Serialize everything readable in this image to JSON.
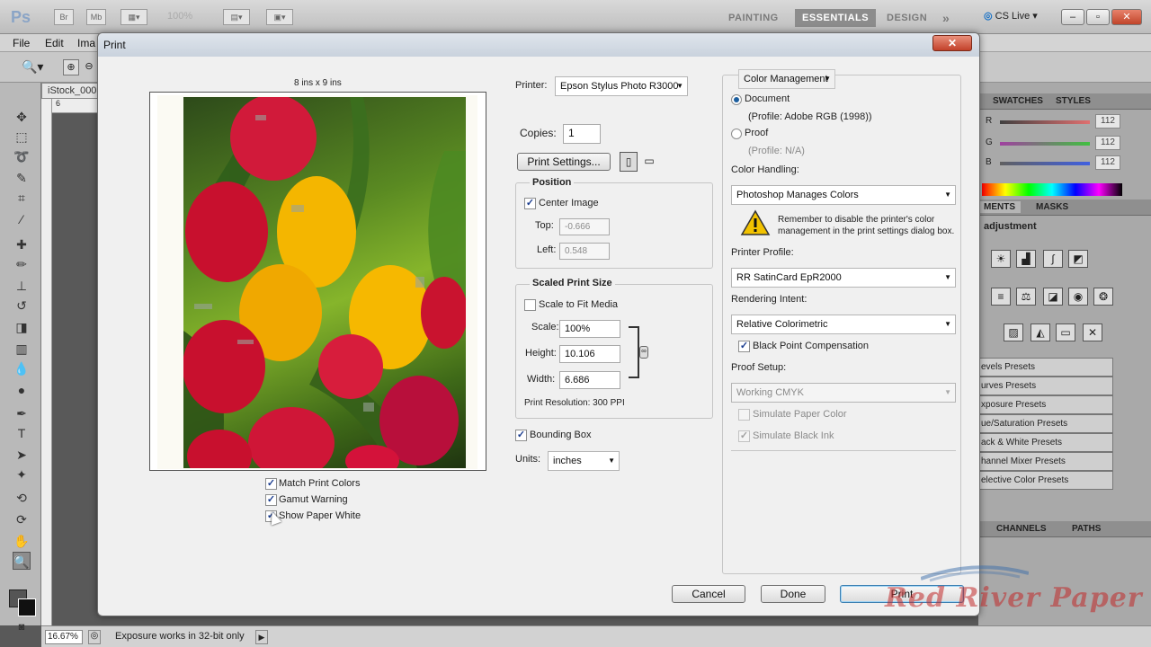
{
  "app": {
    "logo": "Ps",
    "app_buttons": [
      "Br",
      "Mb"
    ],
    "zoom_level": "100%",
    "workspaces": [
      "PAINTING",
      "ESSENTIALS",
      "DESIGN"
    ],
    "active_workspace": "ESSENTIALS",
    "more_workspaces": "»",
    "cs_live": "CS Live",
    "window_controls": [
      "–",
      "▫",
      "✕"
    ]
  },
  "menu": [
    "File",
    "Edit",
    "Ima"
  ],
  "document": {
    "tab_label": "iStock_000",
    "ruler_number": "6",
    "zoom_status": "16.67%",
    "status_message": "Exposure works in 32-bit only"
  },
  "panels": {
    "color_tabs": [
      "SWATCHES",
      "STYLES"
    ],
    "sliders": [
      {
        "label": "R",
        "value": "112",
        "from": "#404040",
        "to": "#e07070"
      },
      {
        "label": "G",
        "value": "112",
        "from": "#a040a0",
        "to": "#40c040"
      },
      {
        "label": "B",
        "value": "112",
        "from": "#606060",
        "to": "#4060e0"
      }
    ],
    "adjust_tabs": [
      "ADJUSTMENTS",
      "MASKS"
    ],
    "adjust_tab_visible": "MENTS",
    "adjust_title": "adjustment",
    "presets": [
      "evels Presets",
      "urves Presets",
      "xposure Presets",
      "ue/Saturation Presets",
      "ack & White Presets",
      "hannel Mixer Presets",
      "elective Color Presets"
    ],
    "bottom_tabs": [
      "CHANNELS",
      "PATHS"
    ]
  },
  "dialog": {
    "title": "Print",
    "close_label": "✕",
    "preview_size": "8 ins x 9 ins",
    "preview_options": [
      {
        "label": "Match Print Colors",
        "checked": true
      },
      {
        "label": "Gamut Warning",
        "checked": true
      },
      {
        "label": "Show Paper White",
        "checked": true
      }
    ],
    "printer_label": "Printer:",
    "printer_value": "Epson Stylus Photo R3000",
    "copies_label": "Copies:",
    "copies_value": "1",
    "print_settings_button": "Print Settings...",
    "position": {
      "title": "Position",
      "center_image": "Center Image",
      "top_label": "Top:",
      "top_value": "-0.666",
      "left_label": "Left:",
      "left_value": "0.548"
    },
    "scaled": {
      "title": "Scaled Print Size",
      "scale_to_fit": "Scale to Fit Media",
      "scale_label": "Scale:",
      "scale_value": "100%",
      "height_label": "Height:",
      "height_value": "10.106",
      "width_label": "Width:",
      "width_value": "6.686",
      "resolution": "Print Resolution: 300 PPI"
    },
    "bounding_box": "Bounding Box",
    "units_label": "Units:",
    "units_value": "inches",
    "color_management": {
      "dropdown": "Color Management",
      "document_label": "Document",
      "document_profile": "(Profile: Adobe RGB (1998))",
      "proof_label": "Proof",
      "proof_profile": "(Profile: N/A)",
      "color_handling_label": "Color Handling:",
      "color_handling_value": "Photoshop Manages Colors",
      "warning_text": "Remember to disable the printer's color management in the print settings dialog box.",
      "printer_profile_label": "Printer Profile:",
      "printer_profile_value": "RR SatinCard EpR2000",
      "rendering_intent_label": "Rendering Intent:",
      "rendering_intent_value": "Relative Colorimetric",
      "black_point": "Black Point Compensation",
      "proof_setup_label": "Proof Setup:",
      "proof_setup_value": "Working CMYK",
      "simulate_paper": "Simulate Paper Color",
      "simulate_ink": "Simulate Black Ink"
    },
    "buttons": {
      "cancel": "Cancel",
      "done": "Done",
      "print": "Print"
    }
  },
  "watermark": "Red River Paper",
  "colors": {
    "accent_blue": "#1c5e9e",
    "warning_yellow": "#f2c200",
    "watermark_red": "#c12a2a"
  }
}
